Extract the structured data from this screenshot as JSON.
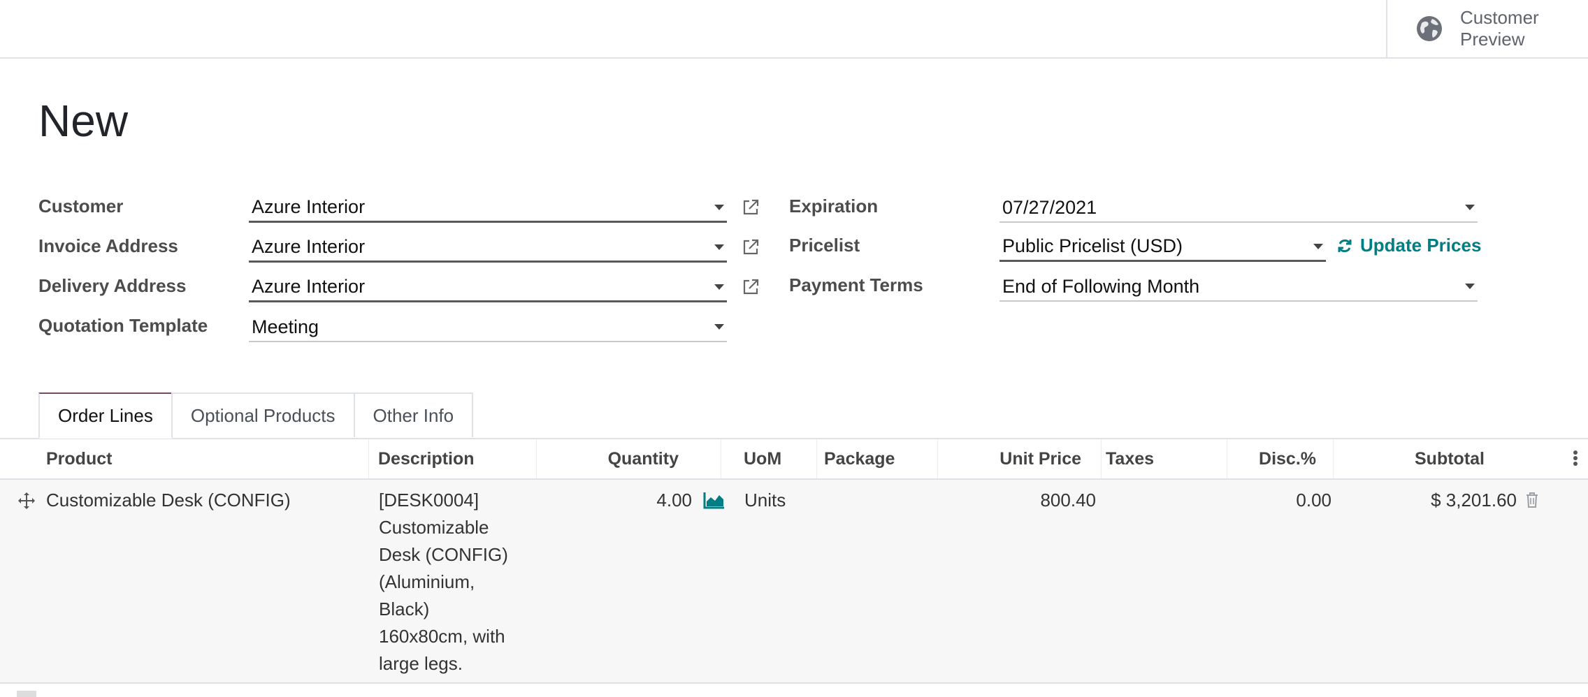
{
  "header": {
    "customer_preview": "Customer\nPreview",
    "globe_icon": "globe-icon"
  },
  "record": {
    "title": "New"
  },
  "form": {
    "customer": {
      "label": "Customer",
      "value": "Azure Interior"
    },
    "invoice_address": {
      "label": "Invoice Address",
      "value": "Azure Interior"
    },
    "delivery_address": {
      "label": "Delivery Address",
      "value": "Azure Interior"
    },
    "quotation_template": {
      "label": "Quotation Template",
      "value": "Meeting"
    },
    "expiration": {
      "label": "Expiration",
      "value": "07/27/2021"
    },
    "pricelist": {
      "label": "Pricelist",
      "value": "Public Pricelist (USD)"
    },
    "update_prices": "Update Prices",
    "payment_terms": {
      "label": "Payment Terms",
      "value": "End of Following Month"
    }
  },
  "tabs": [
    "Order Lines",
    "Optional Products",
    "Other Info"
  ],
  "table": {
    "columns": [
      "Product",
      "Description",
      "Quantity",
      "UoM",
      "Package",
      "Unit Price",
      "Taxes",
      "Disc.%",
      "Subtotal"
    ],
    "rows": [
      {
        "product": "Customizable Desk (CONFIG)",
        "description": "[DESK0004]\nCustomizable\nDesk (CONFIG)\n(Aluminium,\nBlack)\n160x80cm, with\nlarge legs.",
        "quantity": "4.00",
        "uom": "Units",
        "package": "",
        "unit_price": "800.40",
        "taxes": "",
        "discount": "0.00",
        "subtotal": "$ 3,201.60"
      }
    ]
  },
  "colors": {
    "accent": "#017e84",
    "tab_border": "#714b67"
  }
}
